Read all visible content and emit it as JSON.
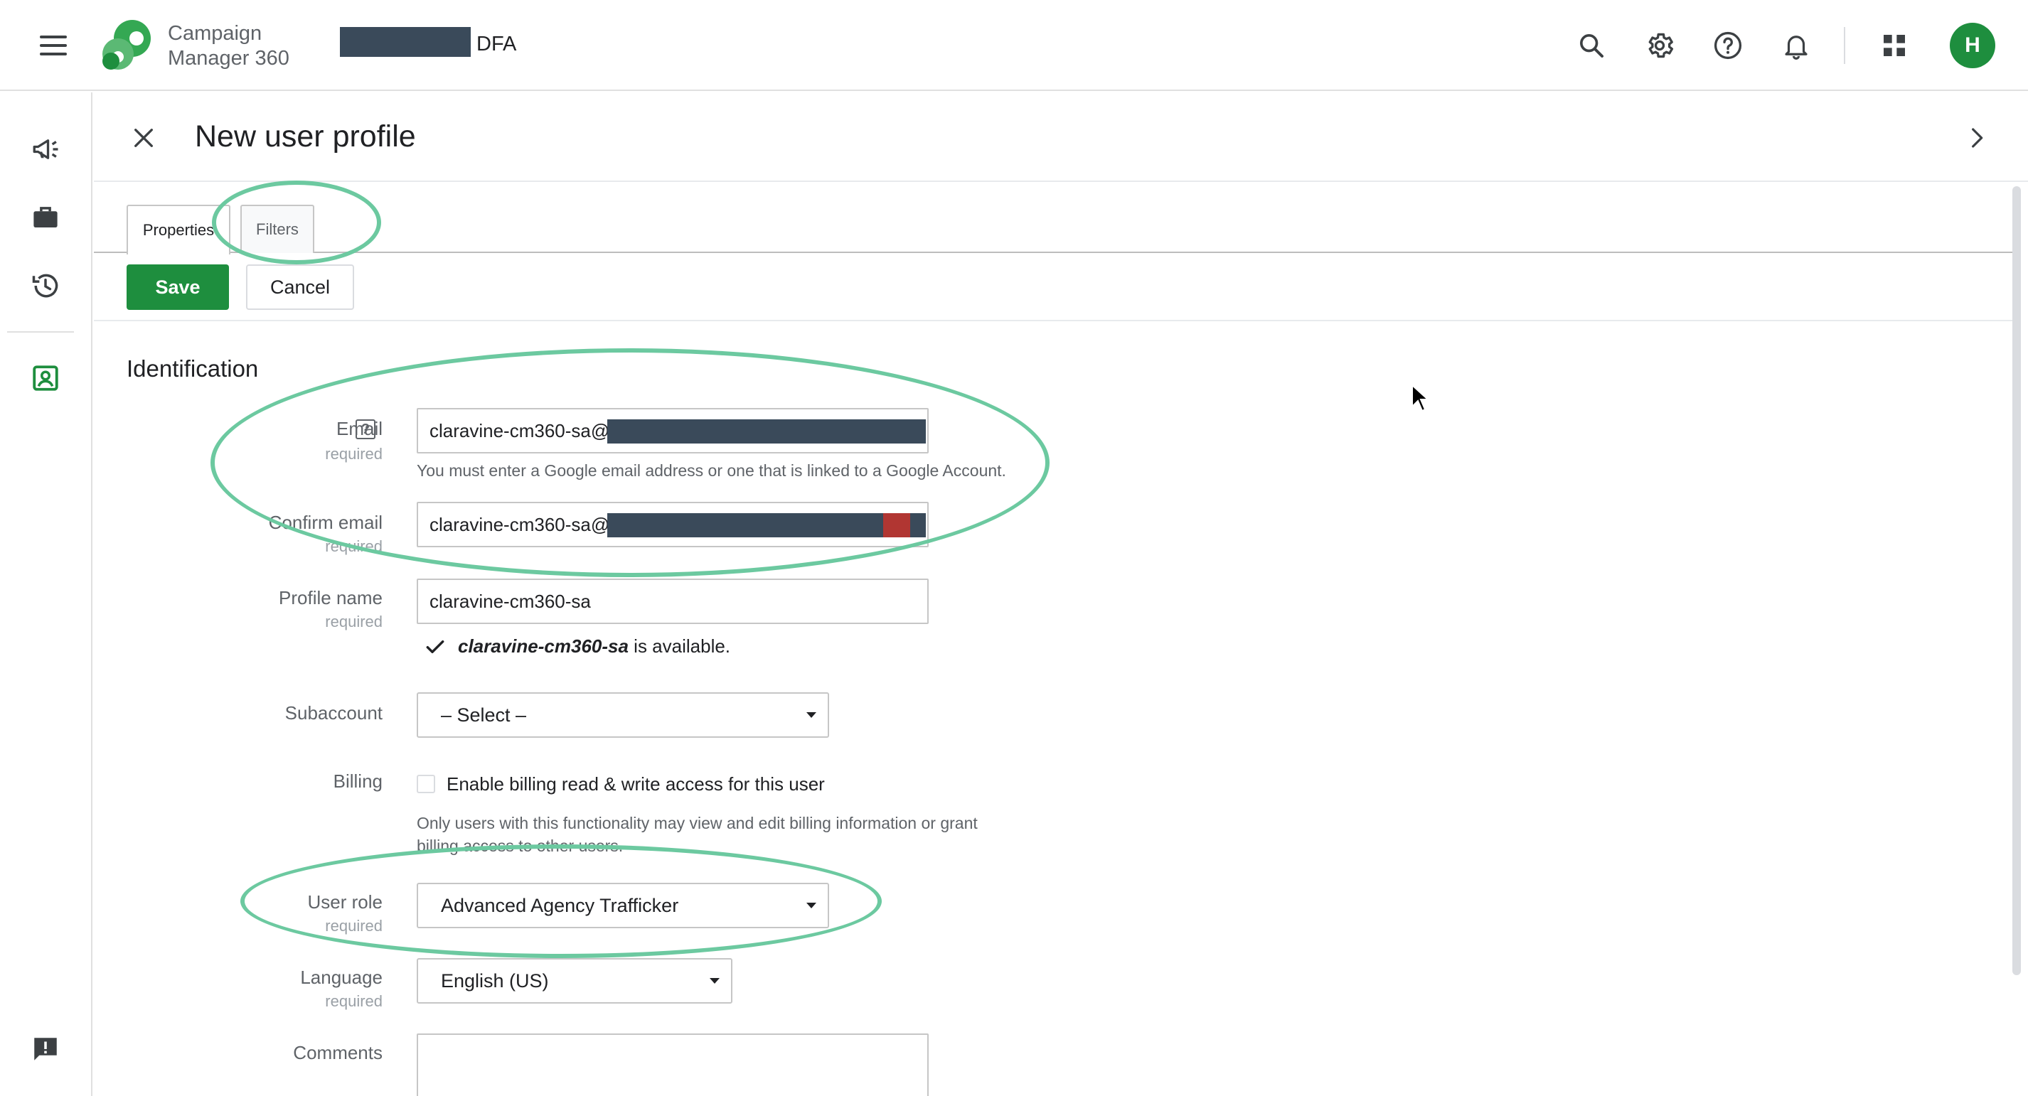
{
  "topbar": {
    "menu_icon": "hamburger-menu-icon",
    "product_name": "Campaign\nManager 360",
    "account_suffix": "DFA",
    "icons": [
      "search-icon",
      "gear-icon",
      "help-icon",
      "bell-icon",
      "apps-grid-icon"
    ],
    "avatar_initial": "H",
    "avatar_color": "#1e8e3e"
  },
  "rail": {
    "icons": [
      "megaphone-icon",
      "briefcase-icon",
      "history-icon",
      "user-profile-icon",
      "feedback-icon"
    ],
    "active_color": "#1e8e3e"
  },
  "panel": {
    "title": "New user profile",
    "tabs": [
      {
        "label": "Properties",
        "active": true
      },
      {
        "label": "Filters",
        "active": false
      }
    ],
    "save_label": "Save",
    "cancel_label": "Cancel"
  },
  "form": {
    "section_title": "Identification",
    "email": {
      "label": "Email",
      "required": "required",
      "help": "?",
      "value": "claravine-cm360-sa@",
      "hint": "You must enter a Google email address or one that is linked to a Google Account."
    },
    "confirm_email": {
      "label": "Confirm email",
      "required": "required",
      "value": "claravine-cm360-sa@"
    },
    "profile_name": {
      "label": "Profile name",
      "required": "required",
      "value": "claravine-cm360-sa",
      "availability_name": "claravine-cm360-sa",
      "availability_suffix": " is available."
    },
    "subaccount": {
      "label": "Subaccount",
      "value": "– Select –"
    },
    "billing": {
      "label": "Billing",
      "checkbox_label": "Enable billing read & write access for this user",
      "hint": "Only users with this functionality may view and edit billing information or grant billing access to other users."
    },
    "user_role": {
      "label": "User role",
      "required": "required",
      "value": "Advanced Agency Trafficker"
    },
    "language": {
      "label": "Language",
      "required": "required",
      "value": "English (US)"
    },
    "comments": {
      "label": "Comments"
    }
  },
  "colors": {
    "brand_green": "#1e8e3e",
    "annotation_ellipse": "#6cc9a0",
    "redaction": "#3a4a5a"
  }
}
